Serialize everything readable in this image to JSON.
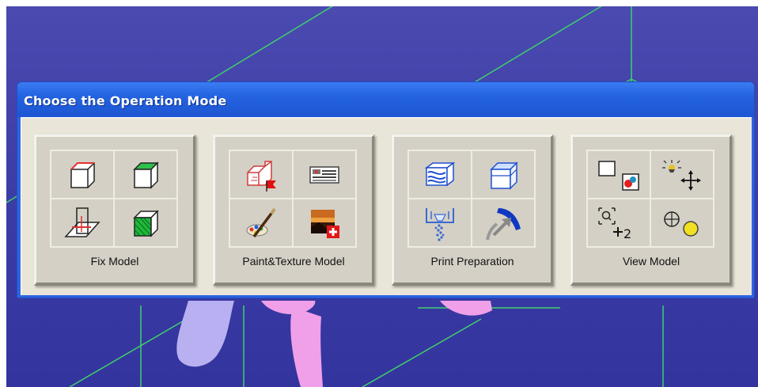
{
  "dialog": {
    "title": "Choose the Operation Mode"
  },
  "modes": [
    {
      "label": "Fix Model",
      "icons": [
        "wireframe-box-red-edge-icon",
        "box-green-top-icon",
        "intersecting-planes-icon",
        "green-faceted-box-icon"
      ]
    },
    {
      "label": "Paint&Texture Model",
      "icons": [
        "paint-block-flag-icon",
        "texture-panel-icon",
        "paint-brush-palette-icon",
        "texture-image-add-icon"
      ]
    },
    {
      "label": "Print Preparation",
      "icons": [
        "slice-layers-icon",
        "blue-box-icon",
        "powder-funnel-icon",
        "extrusion-arrow-icon"
      ]
    },
    {
      "label": "View Model",
      "icons": [
        "view-select-color-icon",
        "light-move-icon",
        "zoom-rotate-icon",
        "orbit-sphere-icon"
      ]
    }
  ],
  "colors": {
    "titlebar": "#2463e0",
    "viewport_background": "#3c3ca6",
    "grid_lines": "#3fd06a",
    "model_pink": "#f0a0e8",
    "model_lavender": "#b8b0f0"
  }
}
